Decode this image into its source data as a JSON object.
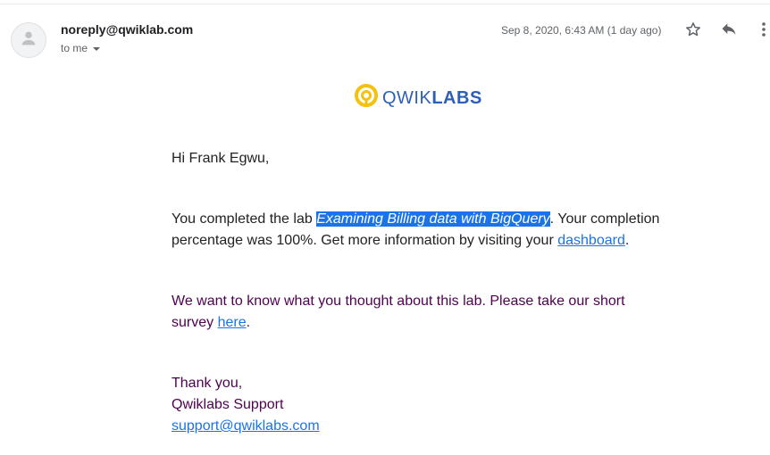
{
  "header": {
    "sender_email": "noreply@qwiklab.com",
    "recipient_label": "to me",
    "date": "Sep 8, 2020, 6:43 AM (1 day ago)"
  },
  "icons": {
    "avatar": "person-icon",
    "star": "star-icon",
    "reply": "reply-icon",
    "more": "more-vert-icon"
  },
  "logo": {
    "part1": "QWIK",
    "part2": "LABS",
    "accent_color": "#f4c20d",
    "brand_color": "#2e5fb7"
  },
  "message": {
    "greeting": "Hi Frank Egwu,",
    "completion_prefix": "You completed the lab ",
    "lab_name": "Examining Billing data with BigQuery",
    "completion_middle": ". Your completion percentage was 100%. Get more information by visiting your ",
    "dashboard_link": "dashboard",
    "completion_end": ".",
    "survey_prefix": "We want to know what you thought about this lab. Please take our short survey ",
    "survey_link": "here",
    "survey_end": ".",
    "thanks": "Thank you,",
    "signature": "Qwiklabs Support",
    "support_email": "support@qwiklabs.com"
  },
  "colors": {
    "link": "#1a73e8",
    "quoted_text": "#500050",
    "selection": "#1a73e8"
  }
}
